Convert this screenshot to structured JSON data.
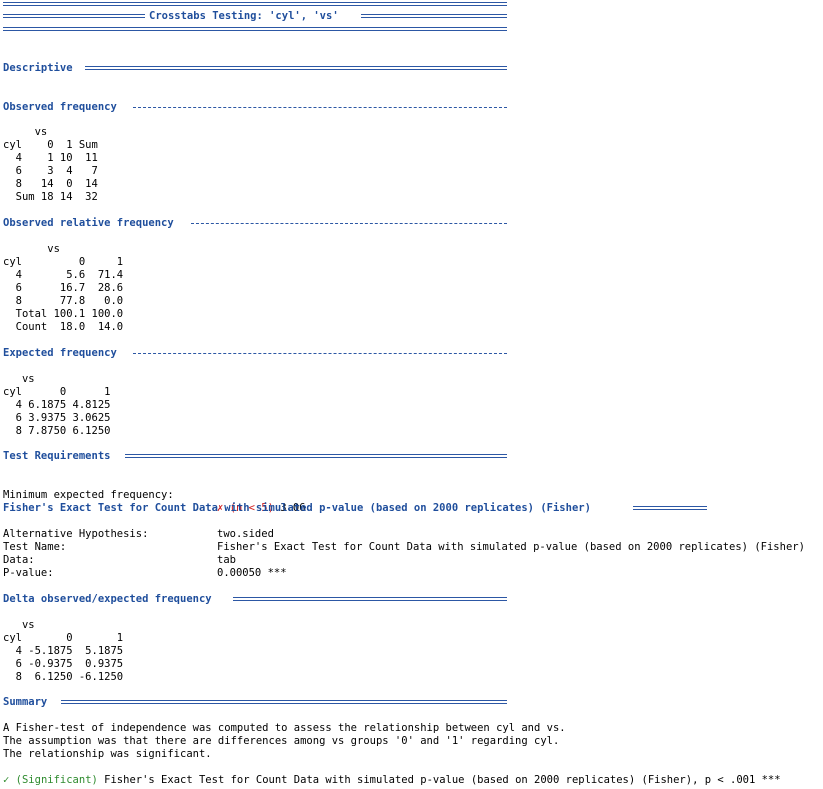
{
  "title": "Crosstabs Testing: 'cyl', 'vs'",
  "sections": {
    "descriptive": "Descriptive",
    "observed_frequency": "Observed frequency",
    "observed_relative_frequency": "Observed relative frequency",
    "expected_frequency": "Expected frequency",
    "test_requirements": "Test Requirements",
    "fisher": "Fisher's Exact Test for Count Data with simulated p-value (based on 2000 replicates) (Fisher)",
    "delta": "Delta observed/expected frequency",
    "summary": "Summary"
  },
  "observed_frequency": [
    "     vs",
    "cyl    0  1 Sum",
    "  4    1 10  11",
    "  6    3  4   7",
    "  8   14  0  14",
    "  Sum 18 14  32"
  ],
  "observed_relative_frequency": [
    "       vs",
    "cyl         0     1",
    "  4       5.6  71.4",
    "  6      16.7  28.6",
    "  8      77.8   0.0",
    "  Total 100.1 100.0",
    "  Count  18.0  14.0"
  ],
  "expected_frequency": [
    "   vs",
    "cyl      0      1",
    "  4 6.1875 4.8125",
    "  6 3.9375 3.0625",
    "  8 7.8750 6.1250"
  ],
  "requirements": {
    "label": "Minimum expected frequency:",
    "mark": "✗",
    "condition": "(n < 5)",
    "value": "3.06"
  },
  "fisher_results": [
    {
      "key": "Alternative Hypothesis:",
      "value": "two.sided"
    },
    {
      "key": "Test Name:",
      "value": "Fisher's Exact Test for Count Data with simulated p-value (based on 2000 replicates) (Fisher)"
    },
    {
      "key": "Data:",
      "value": "tab"
    },
    {
      "key": "P-value:",
      "value": "0.00050 ***"
    }
  ],
  "delta": [
    "   vs",
    "cyl       0       1",
    "  4 -5.1875  5.1875",
    "  6 -0.9375  0.9375",
    "  8  6.1250 -6.1250"
  ],
  "summary_lines": [
    "A Fisher-test of independence was computed to assess the relationship between cyl and vs.",
    "The assumption was that there are differences among vs groups '0' and '1' regarding cyl.",
    "The relationship was significant."
  ],
  "conclusion": {
    "mark": "✓",
    "tag": "(Significant)",
    "text": " Fisher's Exact Test for Count Data with simulated p-value (based on 2000 replicates) (Fisher), p < .001 ***"
  },
  "colors": {
    "heading": "#1f4e9c",
    "rule": "#2c57a4",
    "fail": "#d01c1c",
    "pass": "#2e8b2e"
  }
}
